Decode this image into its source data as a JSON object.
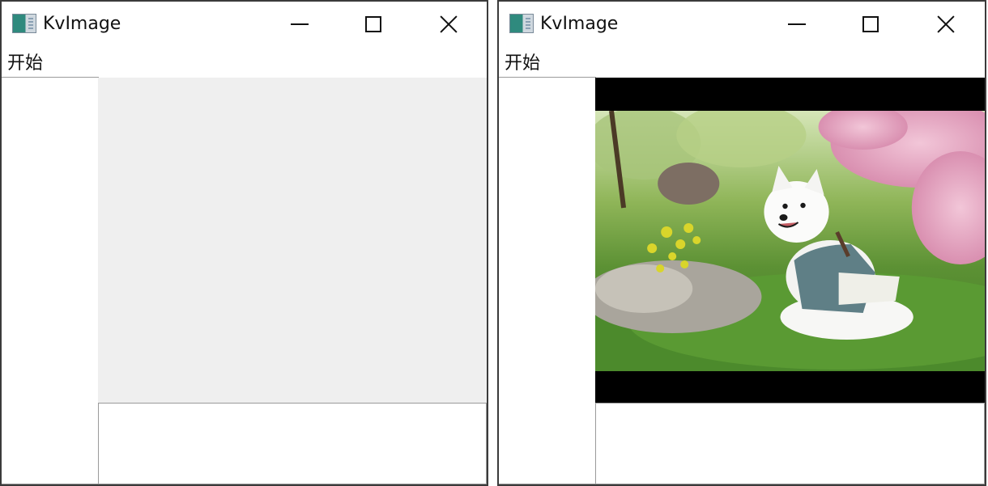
{
  "windows": [
    {
      "title": "KvImage",
      "menu": [
        "开始"
      ],
      "controls": {
        "minimize": "minimize-icon",
        "maximize": "maximize-icon",
        "close": "close-icon"
      },
      "image_loaded": false
    },
    {
      "title": "KvImage",
      "menu": [
        "开始"
      ],
      "controls": {
        "minimize": "minimize-icon",
        "maximize": "maximize-icon",
        "close": "close-icon"
      },
      "image_loaded": true,
      "image_description": "white spitz dog in kimono sitting on grass under cherry blossoms"
    }
  ],
  "colors": {
    "viewport_empty": "#efefef",
    "viewport_letterbox": "#000000",
    "border": "#9a9a9a"
  }
}
